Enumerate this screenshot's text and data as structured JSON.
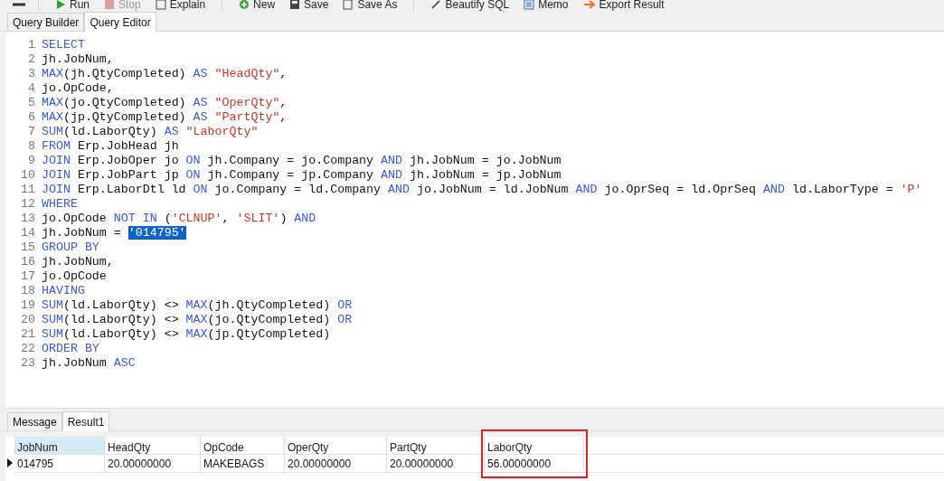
{
  "toolbar": [
    {
      "label": "Run",
      "kind": "run",
      "disabled": false
    },
    {
      "label": "Stop",
      "kind": "stop",
      "disabled": true
    },
    {
      "label": "Explain",
      "kind": "explain",
      "disabled": false
    },
    {
      "label": "New",
      "kind": "new",
      "disabled": false
    },
    {
      "label": "Save",
      "kind": "save",
      "disabled": false
    },
    {
      "label": "Save As",
      "kind": "saveas",
      "disabled": false
    },
    {
      "label": "Beautify SQL",
      "kind": "beautify",
      "disabled": false
    },
    {
      "label": "Memo",
      "kind": "memo",
      "disabled": false
    },
    {
      "label": "Export Result",
      "kind": "export",
      "disabled": false
    }
  ],
  "editor_tabs": [
    {
      "label": "Query Builder",
      "selected": false
    },
    {
      "label": "Query Editor",
      "selected": true
    }
  ],
  "code_lines": [
    {
      "number": "1",
      "tokens": [
        {
          "kind": "keyword",
          "text": "SELECT"
        }
      ]
    },
    {
      "number": "2",
      "tokens": [
        {
          "kind": "plain",
          "text": "jh.JobNum,"
        }
      ]
    },
    {
      "number": "3",
      "tokens": [
        {
          "kind": "keyword",
          "text": "MAX"
        },
        {
          "kind": "plain",
          "text": "(jh.QtyCompleted) "
        },
        {
          "kind": "keyword",
          "text": "AS"
        },
        {
          "kind": "string",
          "text": " \"HeadQty\""
        },
        {
          "kind": "plain",
          "text": ","
        }
      ]
    },
    {
      "number": "4",
      "tokens": [
        {
          "kind": "plain",
          "text": "jo.OpCode,"
        }
      ]
    },
    {
      "number": "5",
      "tokens": [
        {
          "kind": "keyword",
          "text": "MAX"
        },
        {
          "kind": "plain",
          "text": "(jo.QtyCompleted) "
        },
        {
          "kind": "keyword",
          "text": "AS"
        },
        {
          "kind": "string",
          "text": " \"OperQty\""
        },
        {
          "kind": "plain",
          "text": ","
        }
      ]
    },
    {
      "number": "6",
      "tokens": [
        {
          "kind": "keyword",
          "text": "MAX"
        },
        {
          "kind": "plain",
          "text": "(jp.QtyCompleted) "
        },
        {
          "kind": "keyword",
          "text": "AS"
        },
        {
          "kind": "string",
          "text": " \"PartQty\""
        },
        {
          "kind": "plain",
          "text": ","
        }
      ]
    },
    {
      "number": "7",
      "tokens": [
        {
          "kind": "keyword",
          "text": "SUM"
        },
        {
          "kind": "plain",
          "text": "(ld.LaborQty) "
        },
        {
          "kind": "keyword",
          "text": "AS"
        },
        {
          "kind": "string",
          "text": " \"LaborQty\""
        }
      ]
    },
    {
      "number": "8",
      "tokens": [
        {
          "kind": "keyword",
          "text": "FROM"
        },
        {
          "kind": "plain",
          "text": " Erp.JobHead jh"
        }
      ]
    },
    {
      "number": "9",
      "tokens": [
        {
          "kind": "keyword",
          "text": "JOIN"
        },
        {
          "kind": "plain",
          "text": " Erp.JobOper jo "
        },
        {
          "kind": "keyword",
          "text": "ON"
        },
        {
          "kind": "plain",
          "text": " jh.Company = jo.Company "
        },
        {
          "kind": "keyword",
          "text": "AND"
        },
        {
          "kind": "plain",
          "text": " jh.JobNum = jo.JobNum"
        }
      ]
    },
    {
      "number": "10",
      "tokens": [
        {
          "kind": "keyword",
          "text": "JOIN"
        },
        {
          "kind": "plain",
          "text": " Erp.JobPart jp "
        },
        {
          "kind": "keyword",
          "text": "ON"
        },
        {
          "kind": "plain",
          "text": " jh.Company = jp.Company "
        },
        {
          "kind": "keyword",
          "text": "AND"
        },
        {
          "kind": "plain",
          "text": " jh.JobNum = jp.JobNum"
        }
      ]
    },
    {
      "number": "11",
      "tokens": [
        {
          "kind": "keyword",
          "text": "JOIN"
        },
        {
          "kind": "plain",
          "text": " Erp.LaborDtl ld "
        },
        {
          "kind": "keyword",
          "text": "ON"
        },
        {
          "kind": "plain",
          "text": " jo.Company = ld.Company "
        },
        {
          "kind": "keyword",
          "text": "AND"
        },
        {
          "kind": "plain",
          "text": " jo.JobNum = ld.JobNum "
        },
        {
          "kind": "keyword",
          "text": "AND"
        },
        {
          "kind": "plain",
          "text": " jo.OprSeq = ld.OprSeq "
        },
        {
          "kind": "keyword",
          "text": "AND"
        },
        {
          "kind": "plain",
          "text": " ld.LaborType = "
        },
        {
          "kind": "string",
          "text": "'P'"
        }
      ]
    },
    {
      "number": "12",
      "tokens": [
        {
          "kind": "keyword",
          "text": "WHERE"
        }
      ]
    },
    {
      "number": "13",
      "tokens": [
        {
          "kind": "plain",
          "text": "jo.OpCode "
        },
        {
          "kind": "keyword",
          "text": "NOT IN"
        },
        {
          "kind": "plain",
          "text": " ("
        },
        {
          "kind": "string",
          "text": "'CLNUP'"
        },
        {
          "kind": "plain",
          "text": ", "
        },
        {
          "kind": "string",
          "text": "'SLIT'"
        },
        {
          "kind": "plain",
          "text": ") "
        },
        {
          "kind": "keyword",
          "text": "AND"
        }
      ]
    },
    {
      "number": "14",
      "tokens": [
        {
          "kind": "plain",
          "text": "jh.JobNum = "
        },
        {
          "kind": "selection",
          "text": "'014795'"
        }
      ]
    },
    {
      "number": "15",
      "tokens": [
        {
          "kind": "keyword",
          "text": "GROUP BY"
        }
      ]
    },
    {
      "number": "16",
      "tokens": [
        {
          "kind": "plain",
          "text": "jh.JobNum,"
        }
      ]
    },
    {
      "number": "17",
      "tokens": [
        {
          "kind": "plain",
          "text": "jo.OpCode"
        }
      ]
    },
    {
      "number": "18",
      "tokens": [
        {
          "kind": "keyword",
          "text": "HAVING"
        }
      ]
    },
    {
      "number": "19",
      "tokens": [
        {
          "kind": "keyword",
          "text": "SUM"
        },
        {
          "kind": "plain",
          "text": "(ld.LaborQty) <> "
        },
        {
          "kind": "keyword",
          "text": "MAX"
        },
        {
          "kind": "plain",
          "text": "(jh.QtyCompleted) "
        },
        {
          "kind": "keyword",
          "text": "OR"
        }
      ]
    },
    {
      "number": "20",
      "tokens": [
        {
          "kind": "keyword",
          "text": "SUM"
        },
        {
          "kind": "plain",
          "text": "(ld.LaborQty) <> "
        },
        {
          "kind": "keyword",
          "text": "MAX"
        },
        {
          "kind": "plain",
          "text": "(jo.QtyCompleted) "
        },
        {
          "kind": "keyword",
          "text": "OR"
        }
      ]
    },
    {
      "number": "21",
      "tokens": [
        {
          "kind": "keyword",
          "text": "SUM"
        },
        {
          "kind": "plain",
          "text": "(ld.LaborQty) <> "
        },
        {
          "kind": "keyword",
          "text": "MAX"
        },
        {
          "kind": "plain",
          "text": "(jp.QtyCompleted)"
        }
      ]
    },
    {
      "number": "22",
      "tokens": [
        {
          "kind": "keyword",
          "text": "ORDER BY"
        }
      ]
    },
    {
      "number": "23",
      "tokens": [
        {
          "kind": "plain",
          "text": "jh.JobNum "
        },
        {
          "kind": "keyword",
          "text": "ASC"
        }
      ]
    }
  ],
  "result_tabs": [
    {
      "label": "Message",
      "selected": false
    },
    {
      "label": "Result1",
      "selected": true
    }
  ],
  "table": {
    "columns": [
      {
        "label": "JobNum",
        "selected": true,
        "highlighted": false
      },
      {
        "label": "HeadQty",
        "selected": false,
        "highlighted": false
      },
      {
        "label": "OpCode",
        "selected": false,
        "highlighted": false
      },
      {
        "label": "OperQty",
        "selected": false,
        "highlighted": false
      },
      {
        "label": "PartQty",
        "selected": false,
        "highlighted": false
      },
      {
        "label": "LaborQty",
        "selected": false,
        "highlighted": true
      }
    ],
    "rows": [
      {
        "current": true,
        "cells": [
          "014795",
          "20.00000000",
          "MAKEBAGS",
          "20.00000000",
          "20.00000000",
          "56.00000000"
        ]
      }
    ]
  }
}
